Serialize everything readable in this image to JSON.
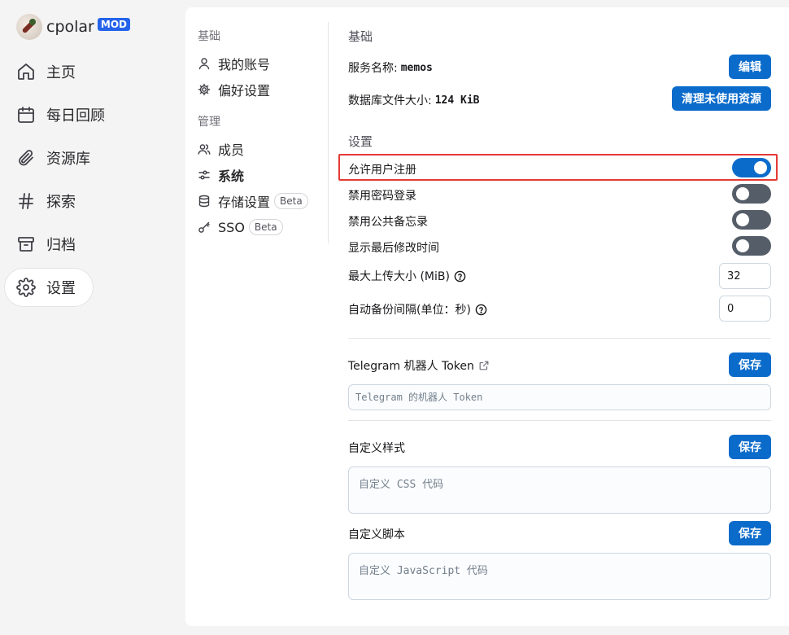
{
  "brand": {
    "name": "cpolar",
    "badge": "MOD"
  },
  "nav": [
    {
      "label": "主页",
      "icon": "home-icon"
    },
    {
      "label": "每日回顾",
      "icon": "calendar-icon"
    },
    {
      "label": "资源库",
      "icon": "paperclip-icon"
    },
    {
      "label": "探索",
      "icon": "hash-icon"
    },
    {
      "label": "归档",
      "icon": "archive-icon"
    },
    {
      "label": "设置",
      "icon": "gear-icon",
      "active": true
    }
  ],
  "settings_nav": {
    "group_basic": "基础",
    "my_account": "我的账号",
    "preferences": "偏好设置",
    "group_admin": "管理",
    "members": "成员",
    "system": "系统",
    "storage": "存储设置",
    "storage_badge": "Beta",
    "sso": "SSO",
    "sso_badge": "Beta"
  },
  "basic": {
    "title": "基础",
    "service_name_label": "服务名称:",
    "service_name_value": "memos",
    "edit_button": "编辑",
    "db_size_label": "数据库文件大小:",
    "db_size_value": "124 KiB",
    "cleanup_button": "清理未使用资源"
  },
  "settings": {
    "title": "设置",
    "allow_signup": {
      "label": "允许用户注册",
      "on": true
    },
    "disable_password_login": {
      "label": "禁用密码登录",
      "on": false
    },
    "disable_public_memos": {
      "label": "禁用公共备忘录",
      "on": false
    },
    "show_last_modified": {
      "label": "显示最后修改时间",
      "on": false
    },
    "max_upload_label": "最大上传大小 (MiB)",
    "max_upload_value": "32",
    "backup_interval_label": "自动备份间隔(单位：秒)",
    "backup_interval_value": "0"
  },
  "telegram": {
    "label": "Telegram 机器人 Token",
    "save_button": "保存",
    "placeholder": "Telegram 的机器人 Token"
  },
  "custom_style": {
    "label": "自定义样式",
    "save_button": "保存",
    "placeholder": "自定义 CSS 代码"
  },
  "custom_script": {
    "label": "自定义脚本",
    "save_button": "保存",
    "placeholder": "自定义 JavaScript 代码"
  },
  "colors": {
    "primary": "#0b6bcb",
    "toggle_off": "#555e68",
    "brand_badge": "#2563eb",
    "highlight": "#e53935"
  }
}
